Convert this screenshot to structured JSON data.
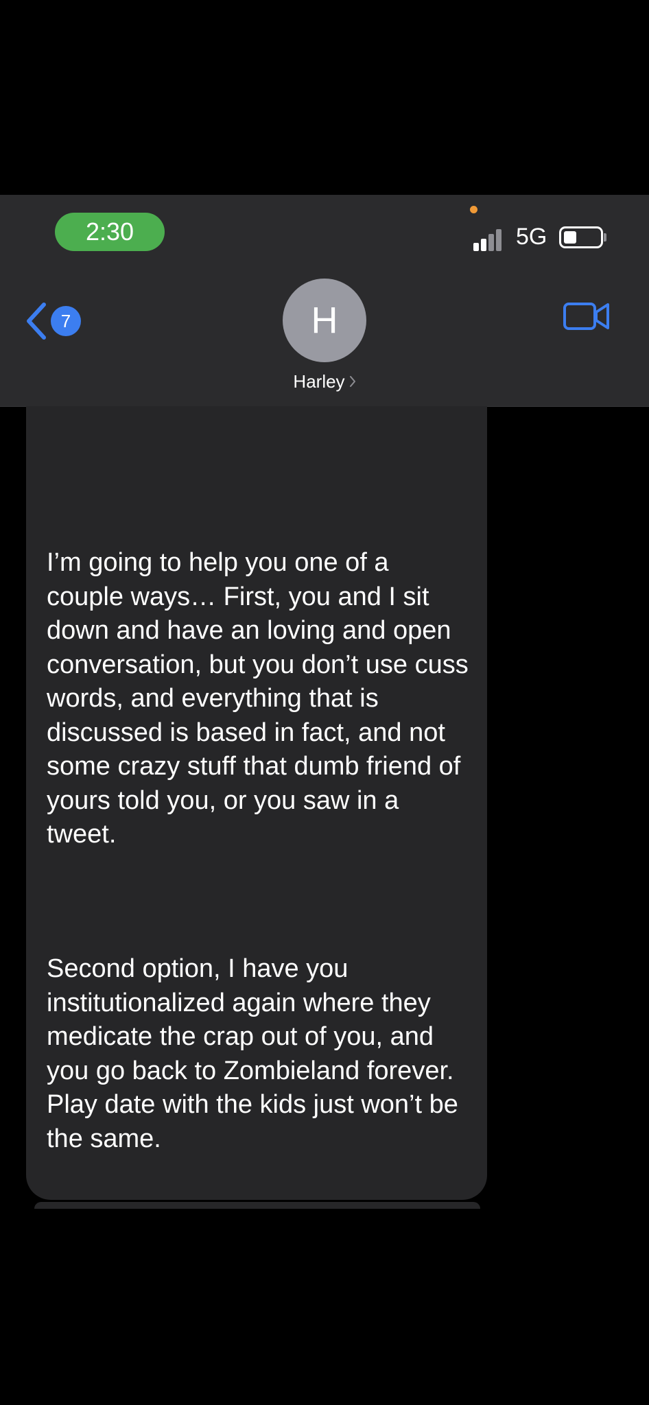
{
  "status_bar": {
    "time": "2:30",
    "network": "5G",
    "signal_bars_active": 2,
    "signal_bars_total": 4
  },
  "nav": {
    "back_badge_count": "7",
    "contact_initial": "H",
    "contact_name": "Harley"
  },
  "message": {
    "paragraph_1": "I’m going to help you one of a couple ways… First, you and I sit down and have an loving and open  conversation, but you don’t use cuss words, and everything that is discussed is based in fact, and not some crazy stuff that dumb friend of yours told you, or you saw in a tweet.",
    "paragraph_2": "Second option, I have you institutionalized again where they medicate the crap out of you, and you go back to Zombieland forever. Play date with the kids just won’t be the same."
  },
  "icons": {
    "back": "chevron-left-icon",
    "video": "video-camera-icon",
    "contact_details": "chevron-right-icon"
  },
  "colors": {
    "accent_blue": "#3c7ef0",
    "time_pill_green": "#4cae4f",
    "privacy_indicator": "#f09a37",
    "bubble_gray": "#262628",
    "header_gray": "#2b2b2d",
    "avatar_gray": "#999aa2"
  }
}
